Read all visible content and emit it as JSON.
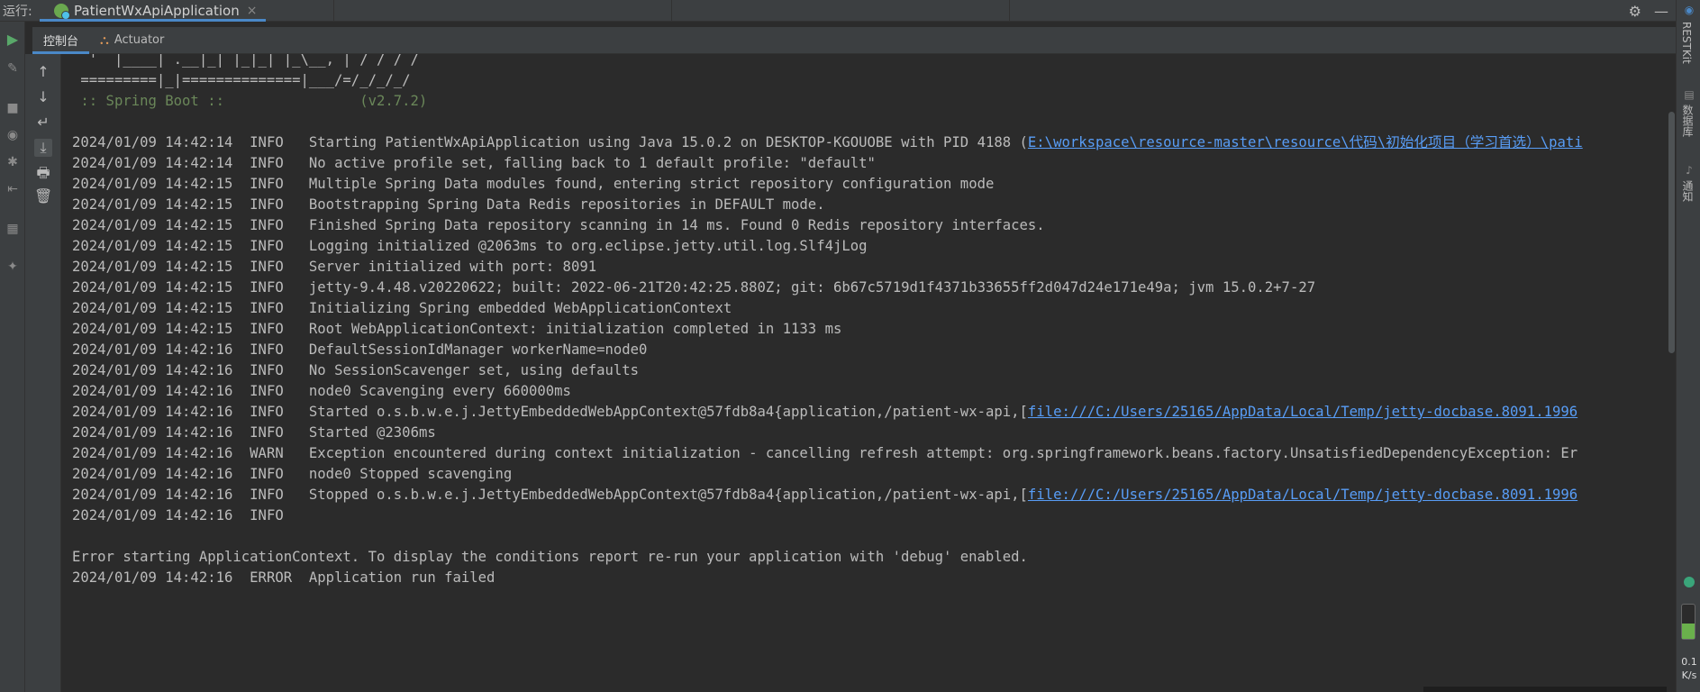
{
  "run_bar": {
    "label": "运行:",
    "tab_title": "PatientWxApiApplication",
    "close": "×"
  },
  "subtabs": [
    {
      "label": "控制台",
      "active": true
    },
    {
      "label": "Actuator",
      "active": false
    }
  ],
  "icons": {
    "settings": "⚙",
    "minimize": "—",
    "play": "▶",
    "wrench": "🔧",
    "up": "↑",
    "down": "↓",
    "wrap": "↵",
    "scroll_end": "⤓",
    "print": "🖶",
    "trash": "🗑"
  },
  "console": {
    "banner": [
      "  '  |____| .__|_| |_|_| |_\\__, | / / / /",
      " =========|_|==============|___/=/_/_/_/",
      " :: Spring Boot ::                (v2.7.2)"
    ],
    "logs": [
      {
        "ts": "2024/01/09 14:42:14",
        "level": "INFO ",
        "msg": "Starting PatientWxApiApplication using Java 15.0.2 on DESKTOP-KGOUOBE with PID 4188 (",
        "link": "E:\\workspace\\resource-master\\resource\\代码\\初始化项目（学习首选）\\pati"
      },
      {
        "ts": "2024/01/09 14:42:14",
        "level": "INFO ",
        "msg": "No active profile set, falling back to 1 default profile: \"default\""
      },
      {
        "ts": "2024/01/09 14:42:15",
        "level": "INFO ",
        "msg": "Multiple Spring Data modules found, entering strict repository configuration mode"
      },
      {
        "ts": "2024/01/09 14:42:15",
        "level": "INFO ",
        "msg": "Bootstrapping Spring Data Redis repositories in DEFAULT mode."
      },
      {
        "ts": "2024/01/09 14:42:15",
        "level": "INFO ",
        "msg": "Finished Spring Data repository scanning in 14 ms. Found 0 Redis repository interfaces."
      },
      {
        "ts": "2024/01/09 14:42:15",
        "level": "INFO ",
        "msg": "Logging initialized @2063ms to org.eclipse.jetty.util.log.Slf4jLog"
      },
      {
        "ts": "2024/01/09 14:42:15",
        "level": "INFO ",
        "msg": "Server initialized with port: 8091"
      },
      {
        "ts": "2024/01/09 14:42:15",
        "level": "INFO ",
        "msg": "jetty-9.4.48.v20220622; built: 2022-06-21T20:42:25.880Z; git: 6b67c5719d1f4371b33655ff2d047d24e171e49a; jvm 15.0.2+7-27"
      },
      {
        "ts": "2024/01/09 14:42:15",
        "level": "INFO ",
        "msg": "Initializing Spring embedded WebApplicationContext"
      },
      {
        "ts": "2024/01/09 14:42:15",
        "level": "INFO ",
        "msg": "Root WebApplicationContext: initialization completed in 1133 ms"
      },
      {
        "ts": "2024/01/09 14:42:16",
        "level": "INFO ",
        "msg": "DefaultSessionIdManager workerName=node0"
      },
      {
        "ts": "2024/01/09 14:42:16",
        "level": "INFO ",
        "msg": "No SessionScavenger set, using defaults"
      },
      {
        "ts": "2024/01/09 14:42:16",
        "level": "INFO ",
        "msg": "node0 Scavenging every 660000ms"
      },
      {
        "ts": "2024/01/09 14:42:16",
        "level": "INFO ",
        "msg": "Started o.s.b.w.e.j.JettyEmbeddedWebAppContext@57fdb8a4{application,/patient-wx-api,[",
        "link": "file:///C:/Users/25165/AppData/Local/Temp/jetty-docbase.8091.1996"
      },
      {
        "ts": "2024/01/09 14:42:16",
        "level": "INFO ",
        "msg": "Started @2306ms"
      },
      {
        "ts": "2024/01/09 14:42:16",
        "level": "WARN ",
        "msg": "Exception encountered during context initialization - cancelling refresh attempt: org.springframework.beans.factory.UnsatisfiedDependencyException: Er"
      },
      {
        "ts": "2024/01/09 14:42:16",
        "level": "INFO ",
        "msg": "node0 Stopped scavenging"
      },
      {
        "ts": "2024/01/09 14:42:16",
        "level": "INFO ",
        "msg": "Stopped o.s.b.w.e.j.JettyEmbeddedWebAppContext@57fdb8a4{application,/patient-wx-api,[",
        "link": "file:///C:/Users/25165/AppData/Local/Temp/jetty-docbase.8091.1996"
      },
      {
        "ts": "2024/01/09 14:42:16",
        "level": "INFO ",
        "msg": ""
      }
    ],
    "error_notice": "Error starting ApplicationContext. To display the conditions report re-run your application with 'debug' enabled.",
    "last_line": {
      "ts": "2024/01/09 14:42:16",
      "level": "ERROR",
      "msg": "Application run failed"
    }
  },
  "right_sidebar": {
    "restkit": "RESTKit",
    "database": "数据库",
    "notifications": "通知",
    "net_speed": "0.1",
    "net_unit": "K/s"
  },
  "colors": {
    "accent": "#4a88c7",
    "link": "#589df6",
    "banner_green": "#6a8759",
    "play_green": "#59a869"
  }
}
